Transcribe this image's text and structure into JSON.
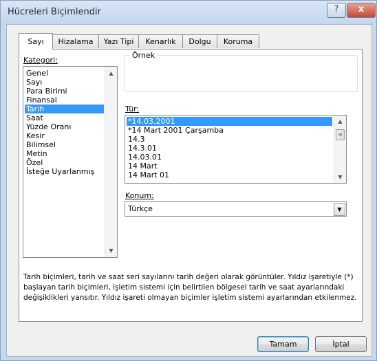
{
  "window": {
    "title": "Hücreleri Biçimlendir",
    "help_glyph": "?",
    "close_glyph": "x"
  },
  "tabs": [
    {
      "label": "Sayı",
      "active": true
    },
    {
      "label": "Hizalama",
      "active": false
    },
    {
      "label": "Yazı Tipi",
      "active": false
    },
    {
      "label": "Kenarlık",
      "active": false
    },
    {
      "label": "Dolgu",
      "active": false
    },
    {
      "label": "Koruma",
      "active": false
    }
  ],
  "category": {
    "label": "Kategori:",
    "items": [
      "Genel",
      "Sayı",
      "Para Birimi",
      "Finansal",
      "Tarih",
      "Saat",
      "Yüzde Oranı",
      "Kesir",
      "Bilimsel",
      "Metin",
      "Özel",
      "İsteğe Uyarlanmış"
    ],
    "selected_index": 4
  },
  "sample": {
    "label": "Örnek",
    "value": ""
  },
  "type": {
    "label": "Tür:",
    "items": [
      "*14.03.2001",
      "*14 Mart 2001 Çarşamba",
      "14.3",
      "14.3.01",
      "14.03.01",
      "14 Mart",
      "14 Mart 01"
    ],
    "selected_index": 0
  },
  "locale": {
    "label": "Konum:",
    "value": "Türkçe"
  },
  "description": [
    "Tarih biçimleri, tarih ve saat seri sayılarını tarih değeri olarak görüntüler. Yıldız işaretiyle (*)",
    "başlayan tarih biçimleri, işletim sistemi için belirtilen bölgesel tarih ve saat ayarlarındaki",
    "değişiklikleri yansıtır. Yıldız işareti olmayan biçimler işletim sistemi ayarlarından etkilenmez."
  ],
  "buttons": {
    "ok": "Tamam",
    "cancel": "İptal"
  },
  "colors": {
    "selection": "#3399ff",
    "titlebar": "#c5d6ec",
    "close_button": "#c24a34"
  }
}
